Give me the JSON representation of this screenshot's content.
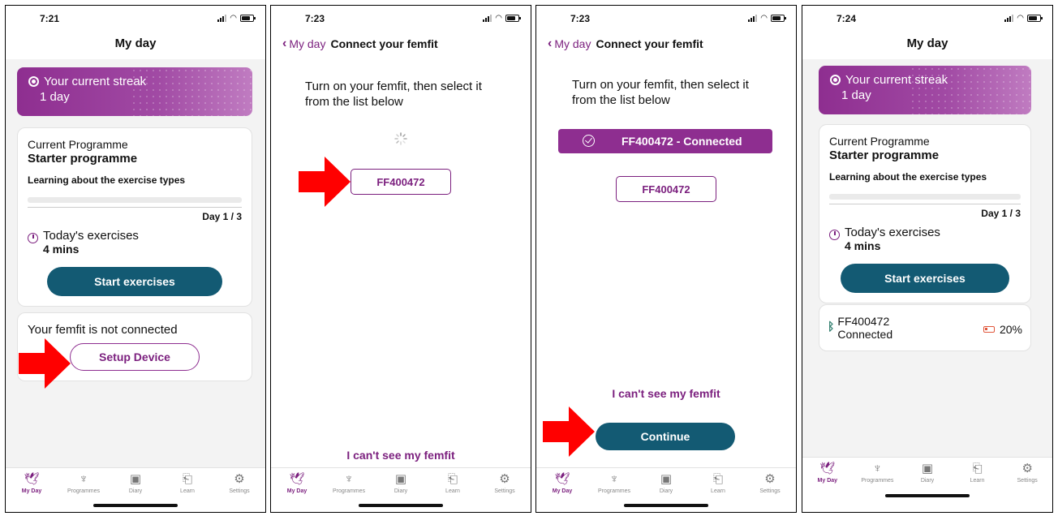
{
  "panels": [
    {
      "status_time": "7:21",
      "header_title": "My day",
      "streak": {
        "label": "Your current streak",
        "value": "1 day"
      },
      "programme": {
        "heading": "Current Programme",
        "name": "Starter programme",
        "description": "Learning about the exercise types",
        "day": "Day 1 / 3",
        "today_label": "Today's exercises",
        "today_duration": "4 mins",
        "start_label": "Start exercises"
      },
      "device_card": {
        "status_text": "Your femfit is not connected",
        "setup_label": "Setup Device"
      }
    },
    {
      "status_time": "7:23",
      "back_label": "My day",
      "header_title": "Connect your femfit",
      "instruction": "Turn on your femfit, then select it from the list below",
      "device_chip": "FF400472",
      "cant_see": "I can't see my femfit"
    },
    {
      "status_time": "7:23",
      "back_label": "My day",
      "header_title": "Connect your femfit",
      "instruction": "Turn on your femfit, then select it from the list below",
      "connected_banner": "FF400472 - Connected",
      "device_chip": "FF400472",
      "cant_see": "I can't see my femfit",
      "continue_label": "Continue"
    },
    {
      "status_time": "7:24",
      "header_title": "My day",
      "streak": {
        "label": "Your current streak",
        "value": "1 day"
      },
      "programme": {
        "heading": "Current Programme",
        "name": "Starter programme",
        "description": "Learning about the exercise types",
        "day": "Day 1 / 3",
        "today_label": "Today's exercises",
        "today_duration": "4 mins",
        "start_label": "Start exercises"
      },
      "femfit": {
        "device": "FF400472",
        "status": "Connected",
        "battery": "20%"
      }
    }
  ],
  "tabs": [
    {
      "label": "My Day",
      "icon": "bird-icon"
    },
    {
      "label": "Programmes",
      "icon": "sprout-icon"
    },
    {
      "label": "Diary",
      "icon": "calendar-icon"
    },
    {
      "label": "Learn",
      "icon": "book-icon"
    },
    {
      "label": "Settings",
      "icon": "gear-icon"
    }
  ],
  "colors": {
    "brand_purple": "#8e2e90",
    "primary_teal": "#135a73",
    "arrow_red": "#ff0000"
  }
}
